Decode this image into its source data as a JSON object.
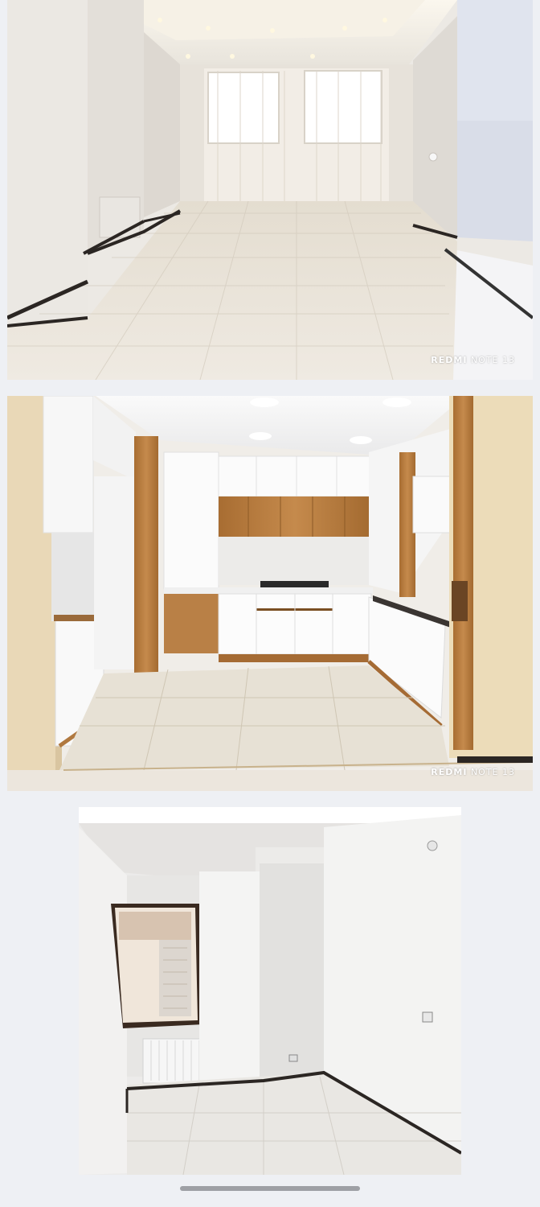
{
  "gallery": {
    "photos": [
      {
        "description_id": "living-room",
        "watermark_brand": "REDMI",
        "watermark_model": "NOTE 13"
      },
      {
        "description_id": "kitchen",
        "watermark_brand": "REDMI",
        "watermark_model": "NOTE 13"
      },
      {
        "description_id": "bedroom"
      }
    ]
  },
  "colors": {
    "background": "#eef0f4",
    "wall": "#f1efec",
    "floor": "#e6e0d4",
    "wood": "#b57a3c",
    "skirting": "#2b2623",
    "cabinet": "#f7f7f7"
  }
}
